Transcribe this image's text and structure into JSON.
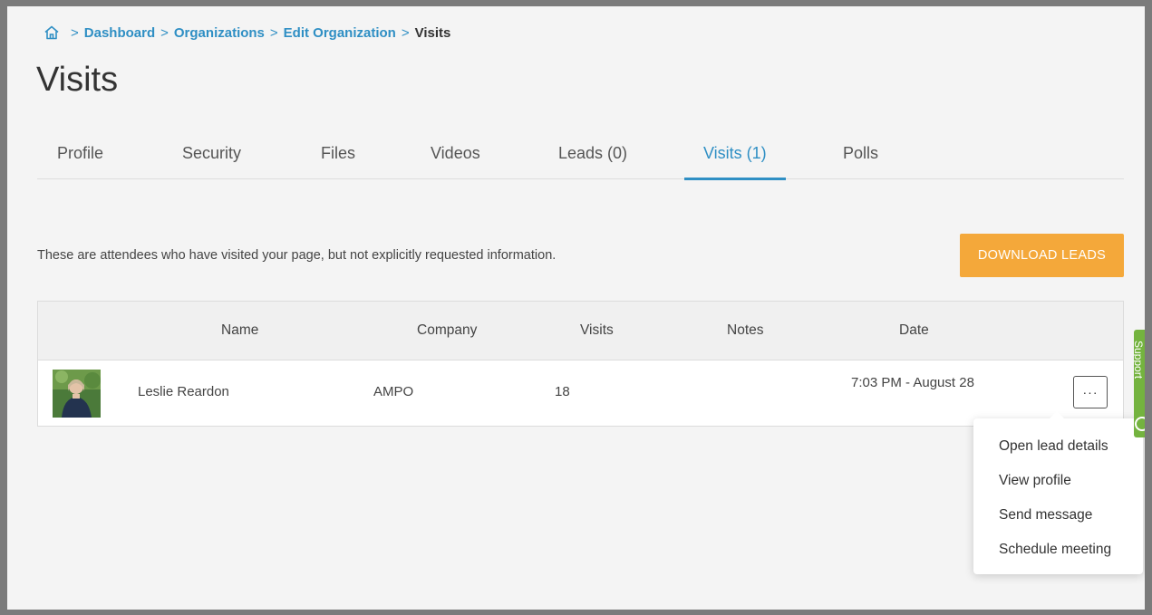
{
  "breadcrumb": {
    "home_icon": "home-icon",
    "items": [
      "Dashboard",
      "Organizations",
      "Edit Organization"
    ],
    "current": "Visits",
    "separator": ">"
  },
  "page": {
    "title": "Visits"
  },
  "tabs": [
    {
      "label": "Profile",
      "active": false
    },
    {
      "label": "Security",
      "active": false
    },
    {
      "label": "Files",
      "active": false
    },
    {
      "label": "Videos",
      "active": false
    },
    {
      "label": "Leads (0)",
      "active": false
    },
    {
      "label": "Visits (1)",
      "active": true
    },
    {
      "label": "Polls",
      "active": false
    }
  ],
  "description": "These are attendees who have visited your page, but not explicitly requested information.",
  "actions": {
    "download_label": "DOWNLOAD LEADS"
  },
  "table": {
    "columns": [
      "Name",
      "Company",
      "Visits",
      "Notes",
      "Date"
    ],
    "rows": [
      {
        "avatar_icon": "user-photo",
        "name": "Leslie Reardon",
        "company": "AMPO",
        "visits": "18",
        "notes": "",
        "date": "7:03 PM - August 28",
        "actions_label": "···"
      }
    ]
  },
  "row_menu": {
    "items": [
      "Open lead details",
      "View profile",
      "Send message",
      "Schedule meeting"
    ]
  },
  "support": {
    "label": "Support",
    "icon": "help-circle-icon"
  },
  "colors": {
    "accent": "#2f8fc4",
    "download_button": "#f4a83a",
    "support_tab": "#74b33f",
    "background": "#f4f4f4"
  }
}
